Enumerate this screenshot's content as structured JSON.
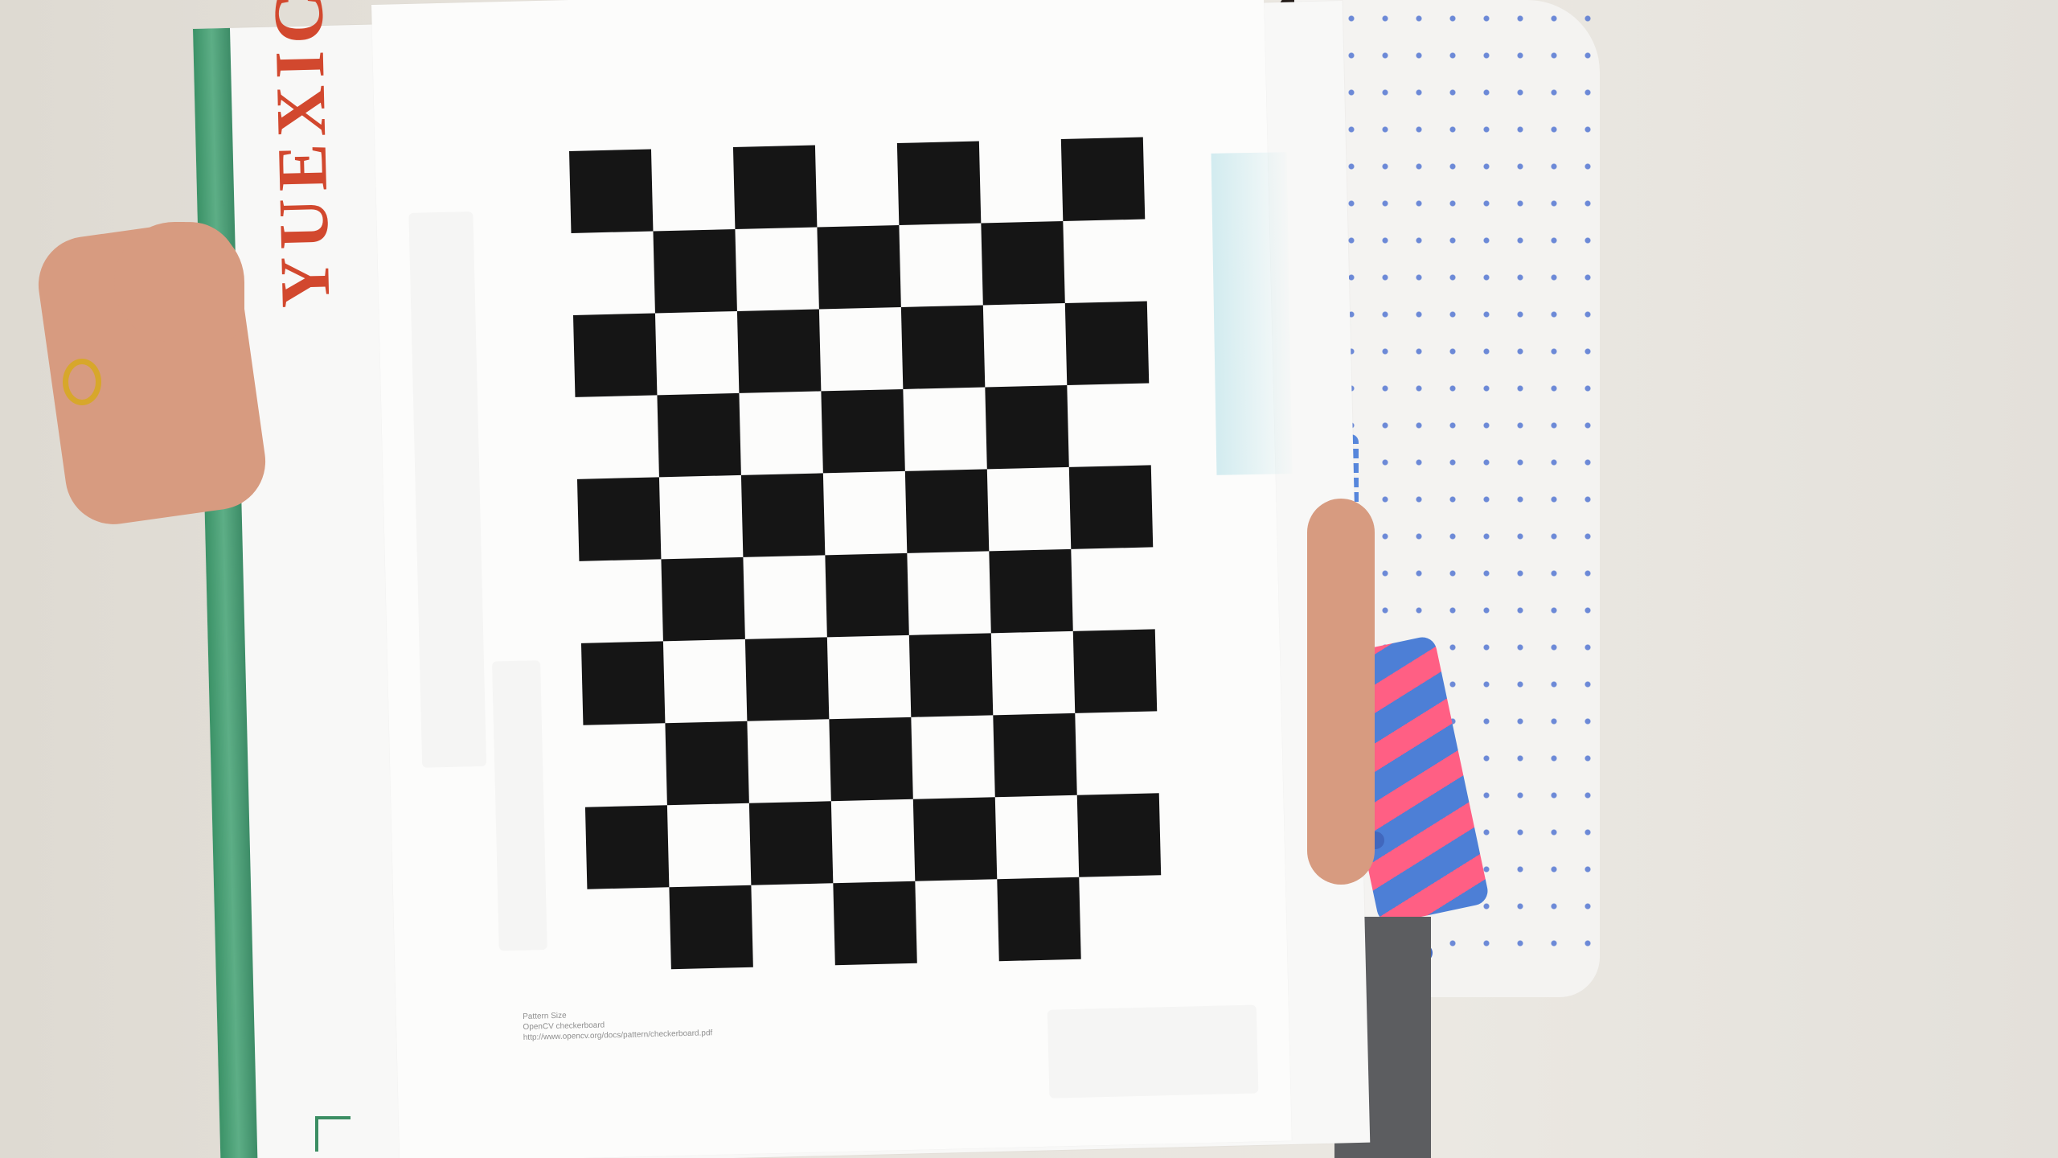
{
  "folder": {
    "brand": "YUEXICUILAN",
    "spine_color": "#3b9267",
    "brand_color": "#d2482e"
  },
  "paper": {
    "checkerboard": {
      "columns": 7,
      "rows": 10,
      "square_color": "#151515"
    },
    "small_print": {
      "line_1": "Pattern  Size",
      "line_2": "OpenCV  checkerboard",
      "line_3": "http://www.opencv.org/docs/pattern/checkerboard.pdf"
    }
  },
  "colors": {
    "background": "#e7e3dc",
    "cardigan": "#f4f3f1",
    "dots": "#4a6fd1",
    "cuff_pink": "#ff5f84",
    "cuff_blue": "#4d7fd6",
    "skin": "#d79b80",
    "hair": "#241c19"
  }
}
